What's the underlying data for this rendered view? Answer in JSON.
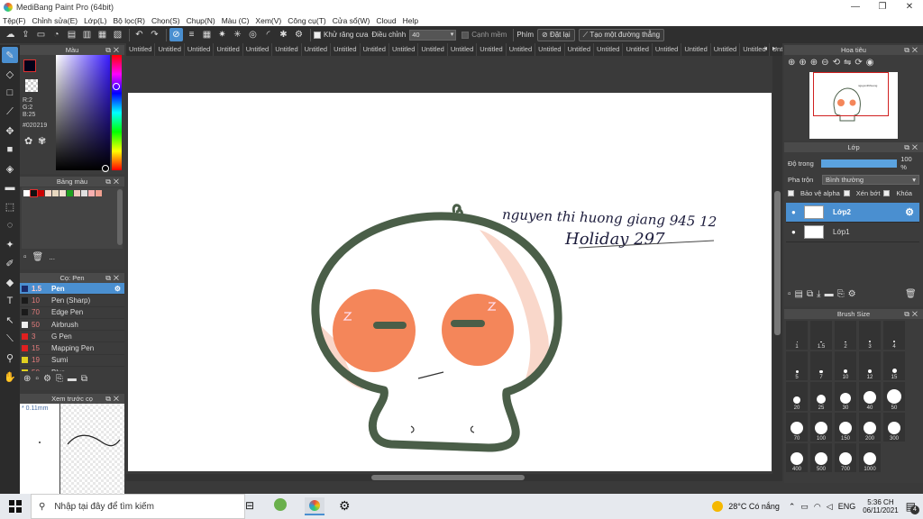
{
  "window": {
    "title": "MediBang Paint Pro (64bit)",
    "buttons": [
      "—",
      "❐",
      "✕"
    ]
  },
  "menu": [
    "Tệp(F)",
    "Chỉnh sửa(E)",
    "Lớp(L)",
    "Bộ lọc(R)",
    "Chọn(S)",
    "Chụp(N)",
    "Màu (C)",
    "Xem(V)",
    "Công cụ(T)",
    "Cửa sổ(W)",
    "Cloud",
    "Help"
  ],
  "toolbar": {
    "antialias_label": "Khử răng cưa",
    "adjust_label": "Điều chỉnh",
    "adjust_value": "40",
    "smooth_label": "Cạnh mềm",
    "key_label": "Phím",
    "reset_label": "Đặt lại",
    "straight_line_label": "Tạo một đường thẳng"
  },
  "tabs": [
    "Untitled",
    "Untitled",
    "Untitled",
    "Untitled",
    "Untitled",
    "Untitled",
    "Untitled",
    "Untitled",
    "Untitled",
    "Untitled",
    "Untitled",
    "Untitled",
    "Untitled",
    "Untitled",
    "Untitled",
    "Untitled",
    "Untitled",
    "Untitled",
    "Untitled",
    "Untitled",
    "Untitled",
    "Untitled",
    "Untitled",
    "Untitled"
  ],
  "color_panel": {
    "title": "Màu",
    "r": "R:2",
    "g": "G:2",
    "b": "B:25",
    "hex": "#020219",
    "fg_color": "#020219",
    "hue_level": 0.27
  },
  "palette_panel": {
    "title": "Bảng màu",
    "colors": [
      "#ffffff",
      "#111111",
      "#cc0000",
      "#f5d5c5",
      "#e8d8c0",
      "#f0e0d0",
      "#20a020",
      "#f0c8c0",
      "#e0e0e0",
      "#f8b0b0",
      "#f0a090"
    ],
    "more": "..."
  },
  "brush_panel": {
    "title": "Cọ: Pen",
    "items": [
      {
        "size": "1.5",
        "name": "Pen",
        "color": "#1a2a6a",
        "selected": true
      },
      {
        "size": "10",
        "name": "Pen (Sharp)",
        "color": "#1a1a1a",
        "selected": false
      },
      {
        "size": "70",
        "name": "Edge Pen",
        "color": "#1a1a1a",
        "selected": false
      },
      {
        "size": "50",
        "name": "Airbrush",
        "color": "#f0f0f0",
        "selected": false
      },
      {
        "size": "3",
        "name": "G Pen",
        "color": "#e02020",
        "selected": false
      },
      {
        "size": "15",
        "name": "Mapping Pen",
        "color": "#e02020",
        "selected": false
      },
      {
        "size": "19",
        "name": "Sumi",
        "color": "#e0d020",
        "selected": false
      },
      {
        "size": "50",
        "name": "Blur",
        "color": "#e0d020",
        "selected": false
      }
    ]
  },
  "preview_panel": {
    "title": "Xem trước cọ",
    "size": "* 0.11mm"
  },
  "navigator": {
    "title": "Hoa tiêu"
  },
  "layer_panel": {
    "title": "Lớp",
    "opacity_label": "Độ trong",
    "opacity_value": "100 %",
    "opacity_level": 1.0,
    "blend_label": "Pha trộn",
    "blend_value": "Bình thường",
    "protect_alpha": "Bảo vệ alpha",
    "clipping": "Xén bớt",
    "lock": "Khóa",
    "layers": [
      {
        "name": "Lớp2",
        "selected": true
      },
      {
        "name": "Lớp1",
        "selected": false
      }
    ]
  },
  "brush_size_panel": {
    "title": "Brush Size",
    "sizes": [
      "1",
      "1.5",
      "2",
      "3",
      "4",
      "5",
      "7",
      "10",
      "12",
      "15",
      "20",
      "25",
      "30",
      "40",
      "50",
      "70",
      "100",
      "150",
      "200",
      "300",
      "400",
      "500",
      "700",
      "1000"
    ]
  },
  "artwork": {
    "line1": "nguyen thi huong giang 945 12",
    "line2": "Holiday 297",
    "outline_color": "#4a5e48",
    "cheek_color": "#f4865a"
  },
  "taskbar": {
    "search_placeholder": "Nhập tại đây để tìm kiếm",
    "weather": "28°C Có nắng",
    "lang": "ENG",
    "time": "5:36 CH",
    "date": "06/11/2021",
    "notifications": "4"
  }
}
